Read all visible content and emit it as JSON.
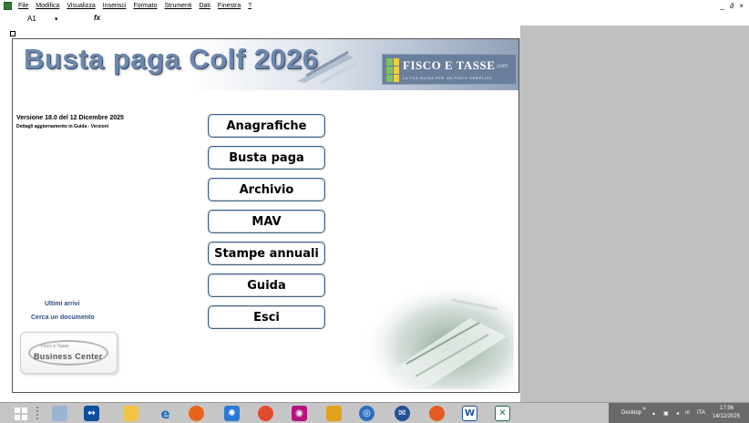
{
  "menubar": {
    "items": [
      "File",
      "Modifica",
      "Visualizza",
      "Inserisci",
      "Formato",
      "Strumenti",
      "Dati",
      "Finestra",
      "?"
    ],
    "window_controls": "_ ∂ ×"
  },
  "formulabar": {
    "cell_ref": "A1",
    "dropdown": "▾",
    "fx": "fx"
  },
  "banner": {
    "title": "Busta paga Colf 2026",
    "logo_brand": "FISCO E TASSE",
    "logo_dotcom": ".com",
    "logo_tagline": "LA TUA GUIDA PER UN FISCO SEMPLICE"
  },
  "version": {
    "line1": "Versione 18.0 del 12 Dicembre 2025",
    "line2": "Dettagli aggiornamento in Guida - Versioni"
  },
  "buttons": {
    "anagrafiche": "Anagrafiche",
    "busta_paga": "Busta paga",
    "archivio": "Archivio",
    "mav": "MAV",
    "stampe_annuali": "Stampe annuali",
    "guida": "Guida",
    "esci": "Esci"
  },
  "links": {
    "ultimi_arrivi": "Ultimi arrivi",
    "cerca_documento": "Cerca un documento"
  },
  "business_center": {
    "small": "Fisco e Tasse",
    "big": "Business Center"
  },
  "taskbar": {
    "icons": [
      "windows-start",
      "file-explorer",
      "teamviewer",
      "folder",
      "internet-explorer",
      "firefox",
      "settings",
      "chrome",
      "camera",
      "sticky-notes",
      "edge",
      "thunderbird",
      "chrome-canary",
      "word",
      "excel"
    ],
    "tray": {
      "desktop": "Desktop",
      "chevron": "»",
      "lang": "ITA",
      "time": "17:56",
      "date": "14/12/2025"
    }
  }
}
